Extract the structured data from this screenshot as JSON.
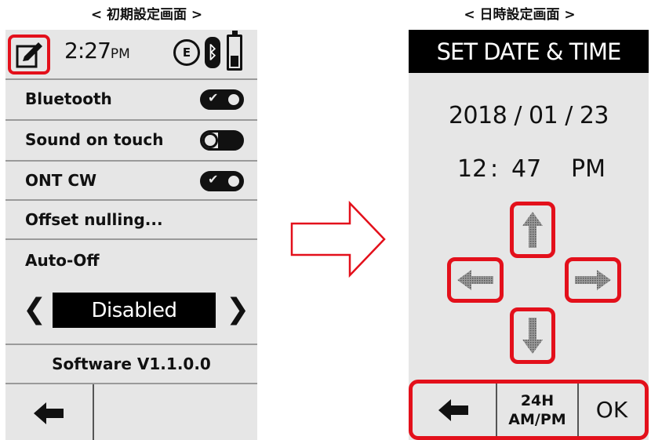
{
  "captions": {
    "left": "< 初期設定画面 >",
    "right": "< 日時設定画面 >"
  },
  "left_screen": {
    "status": {
      "time": "2:27",
      "ampm": "PM",
      "bt_symbol": "ᛒ",
      "sensor_symbol": "E"
    },
    "settings": [
      {
        "label": "Bluetooth",
        "toggle": "on"
      },
      {
        "label": "Sound on touch",
        "toggle": "off"
      },
      {
        "label": "ONT CW",
        "toggle": "on"
      },
      {
        "label": "Offset nulling..."
      }
    ],
    "auto_off": {
      "label": "Auto-Off",
      "value": "Disabled",
      "prev": "❮",
      "next": "❯"
    },
    "software": "Software V1.1.0.0"
  },
  "right_screen": {
    "header": "SET DATE & TIME",
    "date": "2018 / 01 / 23",
    "time": {
      "hour": "12",
      "sep": ":",
      "minute": "47",
      "ampm": "PM"
    },
    "bottom": {
      "format_line1": "24H",
      "format_line2": "AM/PM",
      "ok": "OK"
    }
  },
  "colors": {
    "highlight": "#e3101b",
    "screen_bg": "#e6e6e6",
    "text": "#111111"
  },
  "icons": [
    "edit-icon",
    "bluetooth-icon",
    "battery-icon",
    "back-arrow-icon",
    "up-arrow-icon",
    "down-arrow-icon",
    "left-arrow-icon",
    "right-arrow-icon",
    "right-outline-arrow-icon"
  ]
}
